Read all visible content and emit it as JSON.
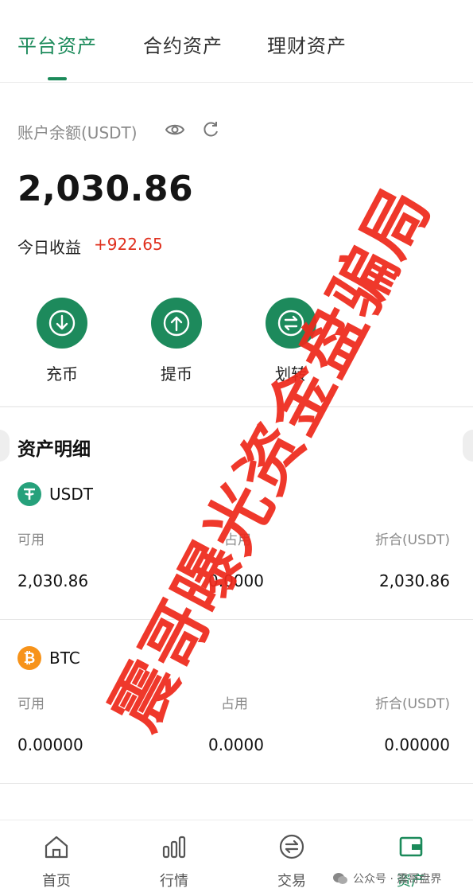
{
  "tabs": [
    {
      "label": "平台资产",
      "active": true
    },
    {
      "label": "合约资产",
      "active": false
    },
    {
      "label": "理财资产",
      "active": false
    }
  ],
  "balance": {
    "label": "账户余额(USDT)",
    "value": "2,030.86",
    "income_label": "今日收益",
    "income_value": "+922.65"
  },
  "actions": [
    {
      "label": "充币",
      "icon": "deposit-arrow-down-icon"
    },
    {
      "label": "提币",
      "icon": "withdraw-arrow-up-icon"
    },
    {
      "label": "划转",
      "icon": "transfer-icon"
    }
  ],
  "details": {
    "title": "资产明细",
    "coins": [
      {
        "name": "USDT",
        "icon": "tether-icon",
        "color": "#26a17b",
        "labels": [
          "可用",
          "占用",
          "折合(USDT)"
        ],
        "values": [
          "2,030.86",
          "0.0000",
          "2,030.86"
        ]
      },
      {
        "name": "BTC",
        "icon": "bitcoin-icon",
        "color": "#f7931a",
        "labels": [
          "可用",
          "占用",
          "折合(USDT)"
        ],
        "values": [
          "0.00000",
          "0.0000",
          "0.00000"
        ]
      }
    ]
  },
  "nav": [
    {
      "label": "首页",
      "icon": "home-icon",
      "active": false
    },
    {
      "label": "行情",
      "icon": "bar-chart-icon",
      "active": false
    },
    {
      "label": "交易",
      "icon": "exchange-icon",
      "active": false
    },
    {
      "label": "资产",
      "icon": "wallet-icon",
      "active": true
    }
  ],
  "watermark": {
    "stamp_text": "震哥曝光资金盘骗局",
    "footer_text": "公众号 · 震哥盘界"
  },
  "colors": {
    "accent": "#1b8a5a",
    "income": "#e0301e",
    "stamp": "#ee2a1c"
  }
}
